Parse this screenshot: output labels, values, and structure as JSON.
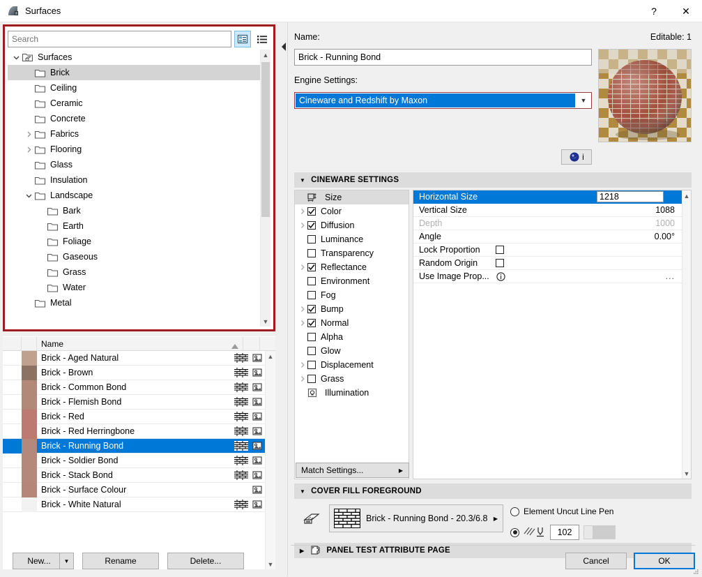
{
  "window": {
    "title": "Surfaces",
    "app_icon": "surface-icon",
    "help_label": "?",
    "close_label": "✕"
  },
  "search": {
    "placeholder": "Search",
    "value": "",
    "tree_view_icon": "tree-view-icon",
    "list_view_icon": "list-view-icon"
  },
  "tree": {
    "items": [
      {
        "label": "Surfaces",
        "depth": 0,
        "expander": "down",
        "icon": "root-folder-icon",
        "selected": false
      },
      {
        "label": "Brick",
        "depth": 1,
        "expander": "none",
        "icon": "folder-icon",
        "selected": true
      },
      {
        "label": "Ceiling",
        "depth": 1,
        "expander": "none",
        "icon": "folder-icon",
        "selected": false
      },
      {
        "label": "Ceramic",
        "depth": 1,
        "expander": "none",
        "icon": "folder-icon",
        "selected": false
      },
      {
        "label": "Concrete",
        "depth": 1,
        "expander": "none",
        "icon": "folder-icon",
        "selected": false
      },
      {
        "label": "Fabrics",
        "depth": 1,
        "expander": "right",
        "icon": "folder-icon",
        "selected": false
      },
      {
        "label": "Flooring",
        "depth": 1,
        "expander": "right",
        "icon": "folder-icon",
        "selected": false
      },
      {
        "label": "Glass",
        "depth": 1,
        "expander": "none",
        "icon": "folder-icon",
        "selected": false
      },
      {
        "label": "Insulation",
        "depth": 1,
        "expander": "none",
        "icon": "folder-icon",
        "selected": false
      },
      {
        "label": "Landscape",
        "depth": 1,
        "expander": "down",
        "icon": "folder-icon",
        "selected": false
      },
      {
        "label": "Bark",
        "depth": 2,
        "expander": "none",
        "icon": "folder-icon",
        "selected": false
      },
      {
        "label": "Earth",
        "depth": 2,
        "expander": "none",
        "icon": "folder-icon",
        "selected": false
      },
      {
        "label": "Foliage",
        "depth": 2,
        "expander": "none",
        "icon": "folder-icon",
        "selected": false
      },
      {
        "label": "Gaseous",
        "depth": 2,
        "expander": "none",
        "icon": "folder-icon",
        "selected": false
      },
      {
        "label": "Grass",
        "depth": 2,
        "expander": "none",
        "icon": "folder-icon",
        "selected": false
      },
      {
        "label": "Water",
        "depth": 2,
        "expander": "none",
        "icon": "folder-icon",
        "selected": false
      },
      {
        "label": "Metal",
        "depth": 1,
        "expander": "none",
        "icon": "folder-icon",
        "selected": false
      }
    ]
  },
  "material_list": {
    "column_header_name": "Name",
    "sort_direction": "ascending",
    "rows": [
      {
        "name": "Brick - Aged Natural",
        "swatch": "#c0a08f",
        "has_pattern": true,
        "has_texture": true,
        "selected": false
      },
      {
        "name": "Brick - Brown",
        "swatch": "#8c7263",
        "has_pattern": true,
        "has_texture": true,
        "selected": false
      },
      {
        "name": "Brick - Common Bond",
        "swatch": "#b28878",
        "has_pattern": true,
        "has_texture": true,
        "selected": false
      },
      {
        "name": "Brick - Flemish Bond",
        "swatch": "#b28878",
        "has_pattern": true,
        "has_texture": true,
        "selected": false
      },
      {
        "name": "Brick - Red",
        "swatch": "#bd7a72",
        "has_pattern": true,
        "has_texture": true,
        "selected": false
      },
      {
        "name": "Brick - Red Herringbone",
        "swatch": "#bd7a72",
        "has_pattern": true,
        "has_texture": true,
        "selected": false
      },
      {
        "name": "Brick - Running Bond",
        "swatch": "#b5887c",
        "has_pattern": true,
        "has_texture": true,
        "selected": true
      },
      {
        "name": "Brick - Soldier Bond",
        "swatch": "#b5887c",
        "has_pattern": true,
        "has_texture": true,
        "selected": false
      },
      {
        "name": "Brick - Stack Bond",
        "swatch": "#b5887c",
        "has_pattern": true,
        "has_texture": true,
        "selected": false
      },
      {
        "name": "Brick - Surface Colour",
        "swatch": "#b5867a",
        "has_pattern": false,
        "has_texture": true,
        "selected": false
      },
      {
        "name": "Brick - White Natural",
        "swatch": "#f2f2f2",
        "has_pattern": true,
        "has_texture": true,
        "selected": false
      }
    ]
  },
  "left_buttons": {
    "new": "New...",
    "new_dropdown_icon": "chevron-down-icon",
    "rename": "Rename",
    "delete": "Delete..."
  },
  "details": {
    "name_label": "Name:",
    "editable_label": "Editable: 1",
    "name_value": "Brick - Running Bond",
    "engine_label": "Engine Settings:",
    "engine_value": "Cineware and Redshift by Maxon",
    "engine_caret_icon": "chevron-down-icon",
    "preview_icon": "material-preview-sphere",
    "info_button_icon": "cinema4d-icon",
    "info_button_label": "i"
  },
  "cineware": {
    "section_title": "CINEWARE SETTINGS",
    "section_collapse_icon": "triangle-down-icon",
    "channels": [
      {
        "label": "Size",
        "kind": "icon",
        "icon": "size-icon",
        "expander": "none",
        "checked": false,
        "selected": true
      },
      {
        "label": "Color",
        "kind": "checkbox",
        "icon": "",
        "expander": "right",
        "checked": true,
        "selected": false
      },
      {
        "label": "Diffusion",
        "kind": "checkbox",
        "icon": "",
        "expander": "right",
        "checked": true,
        "selected": false
      },
      {
        "label": "Luminance",
        "kind": "checkbox",
        "icon": "",
        "expander": "none",
        "checked": false,
        "selected": false
      },
      {
        "label": "Transparency",
        "kind": "checkbox",
        "icon": "",
        "expander": "none",
        "checked": false,
        "selected": false
      },
      {
        "label": "Reflectance",
        "kind": "checkbox",
        "icon": "",
        "expander": "right",
        "checked": true,
        "selected": false
      },
      {
        "label": "Environment",
        "kind": "checkbox",
        "icon": "",
        "expander": "none",
        "checked": false,
        "selected": false
      },
      {
        "label": "Fog",
        "kind": "checkbox",
        "icon": "",
        "expander": "none",
        "checked": false,
        "selected": false
      },
      {
        "label": "Bump",
        "kind": "checkbox",
        "icon": "",
        "expander": "right",
        "checked": true,
        "selected": false
      },
      {
        "label": "Normal",
        "kind": "checkbox",
        "icon": "",
        "expander": "right",
        "checked": true,
        "selected": false
      },
      {
        "label": "Alpha",
        "kind": "checkbox",
        "icon": "",
        "expander": "none",
        "checked": false,
        "selected": false
      },
      {
        "label": "Glow",
        "kind": "checkbox",
        "icon": "",
        "expander": "none",
        "checked": false,
        "selected": false
      },
      {
        "label": "Displacement",
        "kind": "checkbox",
        "icon": "",
        "expander": "right",
        "checked": false,
        "selected": false
      },
      {
        "label": "Grass",
        "kind": "checkbox",
        "icon": "",
        "expander": "right",
        "checked": false,
        "selected": false
      },
      {
        "label": "Illumination",
        "kind": "icon",
        "icon": "illumination-icon",
        "expander": "none",
        "checked": false,
        "selected": false
      }
    ],
    "match_settings_label": "Match Settings...",
    "match_settings_arrow_icon": "triangle-right-icon",
    "properties": [
      {
        "label": "Horizontal Size",
        "value": "1218",
        "type": "editing",
        "selected": true,
        "dimmed": false
      },
      {
        "label": "Vertical Size",
        "value": "1088",
        "type": "text",
        "selected": false,
        "dimmed": false
      },
      {
        "label": "Depth",
        "value": "1000",
        "type": "text",
        "selected": false,
        "dimmed": true
      },
      {
        "label": "Angle",
        "value": "0.00°",
        "type": "text",
        "selected": false,
        "dimmed": false
      },
      {
        "label": "Lock Proportion",
        "value": "",
        "type": "checkbox",
        "checked": false,
        "selected": false,
        "dimmed": false
      },
      {
        "label": "Random Origin",
        "value": "",
        "type": "checkbox",
        "checked": false,
        "selected": false,
        "dimmed": false
      },
      {
        "label": "Use Image Prop...",
        "value": "...",
        "type": "info",
        "selected": false,
        "dimmed": false
      }
    ]
  },
  "cover_fill": {
    "section_title": "COVER FILL FOREGROUND",
    "section_collapse_icon": "triangle-down-icon",
    "fill_icon": "cover-fill-icon",
    "fill_pattern_icon": "brick-pattern-icon",
    "fill_value": "Brick - Running Bond - 20.3/6.8",
    "fill_arrow_icon": "triangle-right-icon",
    "option_uncut_pen_label": "Element Uncut Line Pen",
    "option_uncut_pen_selected": false,
    "option_custom_pen_selected": true,
    "custom_pen_icon": "hatch-pen-icon",
    "pen_number": "102",
    "pen_color": "#cdcdcd"
  },
  "panel_test": {
    "section_title": "PANEL TEST ATTRIBUTE PAGE",
    "section_expand_icon": "triangle-right-icon",
    "icon": "panel-icon"
  },
  "right_buttons": {
    "cancel": "Cancel",
    "ok": "OK"
  },
  "colors": {
    "accent": "#0078d7",
    "highlight_border": "#a11b20",
    "section_bg": "#dcdcdc"
  }
}
